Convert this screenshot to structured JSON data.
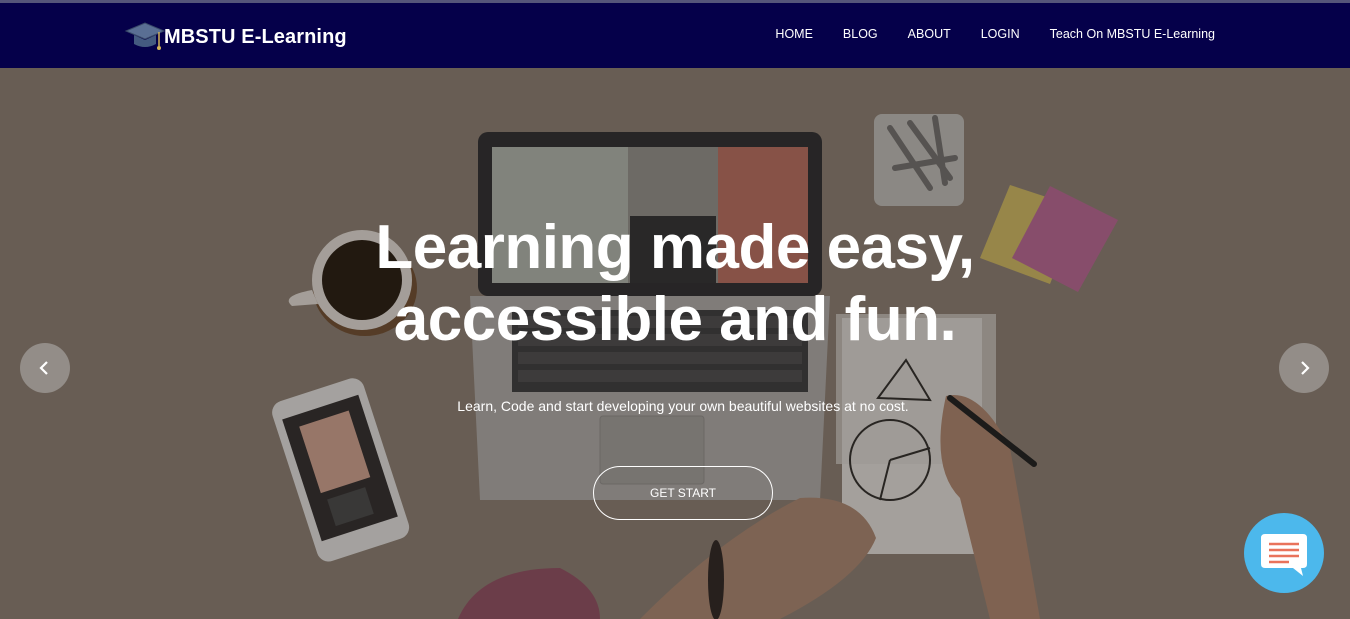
{
  "header": {
    "brand": "MBSTU E-Learning",
    "nav": [
      {
        "label": "HOME"
      },
      {
        "label": "BLOG"
      },
      {
        "label": "ABOUT"
      },
      {
        "label": "LOGIN"
      },
      {
        "label": "Teach On MBSTU E-Learning"
      }
    ]
  },
  "hero": {
    "headline_line1": "Learning made easy,",
    "headline_line2": "accessible and fun.",
    "subtitle": "Learn, Code and start developing your own beautiful websites at no cost.",
    "cta_label": "GET START",
    "prev_icon": "chevron-left-icon",
    "next_icon": "chevron-right-icon"
  },
  "chat": {
    "icon": "chat-bubble-icon",
    "color": "#4cb8ec"
  },
  "colors": {
    "header_bg": "#05004a",
    "accent": "#4cb8ec"
  }
}
